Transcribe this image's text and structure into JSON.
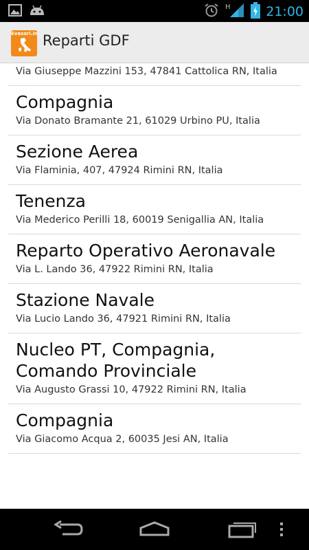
{
  "status_bar": {
    "time": "21:00",
    "icons": [
      "image-icon",
      "android-icon",
      "alarm-icon",
      "signal-icon",
      "battery-charging-icon"
    ],
    "network_type": "H",
    "accent": "#33b5e5"
  },
  "action_bar": {
    "icon_label": "Evasori.info",
    "title": "Reparti GDF",
    "icon_color": "#f28a1a"
  },
  "list": {
    "items": [
      {
        "title": "",
        "address": "Via Giuseppe Mazzini 153, 47841 Cattolica RN, Italia"
      },
      {
        "title": "Compagnia",
        "address": "Via Donato Bramante 21, 61029 Urbino PU, Italia"
      },
      {
        "title": "Sezione Aerea",
        "address": "Via Flaminia, 407, 47924 Rimini RN, Italia"
      },
      {
        "title": "Tenenza",
        "address": "Via Mederico Perilli 18, 60019 Senigallia AN, Italia"
      },
      {
        "title": "Reparto Operativo Aeronavale",
        "address": "Via L. Lando 36, 47922 Rimini RN, Italia"
      },
      {
        "title": "Stazione Navale",
        "address": "Via Lucio Lando 36, 47921 Rimini RN, Italia"
      },
      {
        "title": "Nucleo PT, Compagnia, Comando Provinciale",
        "address": "Via Augusto Grassi 10, 47922 Rimini RN, Italia"
      },
      {
        "title": "Compagnia",
        "address": "Via Giacomo Acqua 2, 60035 Jesi AN, Italia"
      }
    ]
  },
  "nav_bar": {
    "icons": [
      "back-icon",
      "home-icon",
      "recent-apps-icon",
      "overflow-menu-icon"
    ]
  }
}
